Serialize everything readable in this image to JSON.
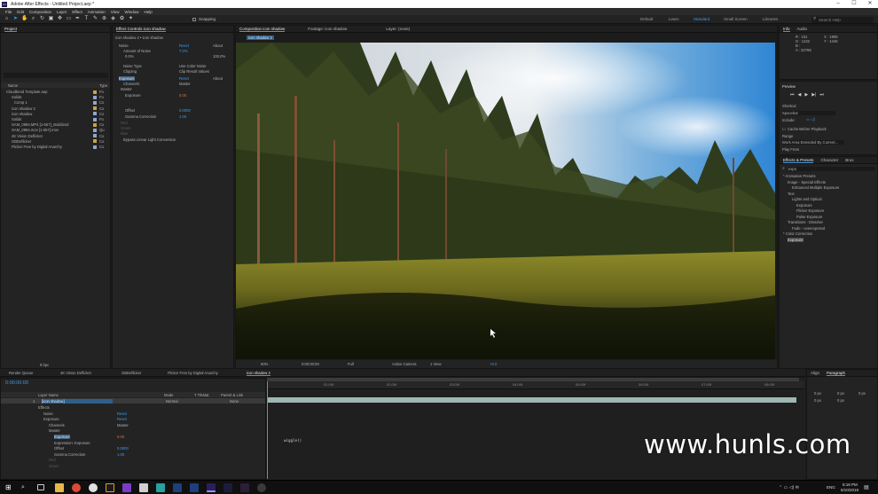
{
  "app": {
    "title": "Adobe After Effects - Untitled Project.aep *",
    "menu": [
      "File",
      "Edit",
      "Composition",
      "Layer",
      "Effect",
      "Animation",
      "View",
      "Window",
      "Help"
    ],
    "snapping_label": "Snapping"
  },
  "workspaces": {
    "items": [
      "Default",
      "Learn",
      "Standard",
      "Small Screen",
      "Libraries"
    ],
    "active": "Standard",
    "search_placeholder": "Search Help"
  },
  "project_panel": {
    "tab": "Project",
    "search_placeholder": "",
    "col_name": "Name",
    "col_type": "Type",
    "items": [
      {
        "name": "Cloudbend Template.aep",
        "type": "Fo"
      },
      {
        "name": "Solids",
        "type": "Fo"
      },
      {
        "name": "Comp 1",
        "type": "Co"
      },
      {
        "name": "icon shadow 2",
        "type": "Co"
      },
      {
        "name": "icon shadow",
        "type": "Co"
      },
      {
        "name": "Solids",
        "type": "Fo"
      },
      {
        "name": "SAM_0894.MP4 [1-557]_stabilized",
        "type": "Co"
      },
      {
        "name": "SAM_0894.mov [1-557].mov",
        "type": "Qu"
      },
      {
        "name": "4K Vision Deflicker",
        "type": "Co"
      },
      {
        "name": "GBDeflicker",
        "type": "Co"
      },
      {
        "name": "Flicker Free by Digital Anarchy",
        "type": "Co"
      }
    ],
    "bottom_label": "8 bpc"
  },
  "effect_controls": {
    "tab": "Effect Controls icon shadow",
    "header": "icon shadow 2 • icon shadow",
    "rows": [
      {
        "label": "Noise",
        "val1": "Reset",
        "val2": "About"
      },
      {
        "label": "Amount of Noise",
        "val1": "7.0%",
        "val2": ""
      },
      {
        "label": "0.0%",
        "val1": "",
        "val2": "100.0%"
      },
      {
        "label": "Noise Type",
        "val1": "Use Color Noise",
        "val2": ""
      },
      {
        "label": "Clipping",
        "val1": "Clip Result Values",
        "val2": ""
      },
      {
        "label": "Exposure",
        "val1": "Reset",
        "val2": "About"
      },
      {
        "label": "Channels:",
        "val1": "Master",
        "val2": ""
      },
      {
        "label": "Master",
        "val1": "",
        "val2": ""
      },
      {
        "label": "Exposure",
        "val1": "0.00",
        "val2": ""
      },
      {
        "label": "Offset",
        "val1": "0.0000",
        "val2": ""
      },
      {
        "label": "Gamma Correction",
        "val1": "1.00",
        "val2": ""
      },
      {
        "label": "Red",
        "val1": "",
        "val2": ""
      },
      {
        "label": "Green",
        "val1": "",
        "val2": ""
      },
      {
        "label": "Blue",
        "val1": "",
        "val2": ""
      },
      {
        "label": "Bypass Linear Light Conversion",
        "val1": "",
        "val2": ""
      }
    ]
  },
  "viewer": {
    "tabs": [
      "Composition icon shadow",
      "Footage: icon shadow",
      "Layer: (none)"
    ],
    "crumb": "icon shadow 2",
    "footer": {
      "zoom": "50%",
      "timecode": "0;00;00;00",
      "resolution": "Full",
      "camera": "Active Camera",
      "views": "1 View",
      "exposure": "+0.0"
    }
  },
  "info_panel": {
    "tabs": [
      "Info",
      "Audio"
    ],
    "r": "R : 151",
    "g": "G : 1232",
    "b": "B :",
    "a": "A : 32768",
    "x": "X : 1955",
    "y": "Y : 1346"
  },
  "preview_panel": {
    "title": "Preview",
    "shortcut_label": "Shortcut",
    "shortcut_value": "Spacebar",
    "include_label": "Include:",
    "cache_label": "Cache Before Playback",
    "range_label": "Range",
    "range_value": "Work Area Extended By Current...",
    "play_from_label": "Play From"
  },
  "effects_panel": {
    "tabs": [
      "Effects & Presets",
      "Character",
      "Brus"
    ],
    "search_value": "expo",
    "tree": [
      "* Animation Presets",
      "Image - Special Effects",
      "Enhanced Multiple Exposure",
      "Text",
      "Lights and Optical",
      "Exposure",
      "Flicker Exposure",
      "Pulse Exposure",
      "Transitions - Dissolve",
      "Fade - overexposed",
      "* Color Correction",
      "Exposure"
    ]
  },
  "bottom_tabs": [
    "Render Queue",
    "4K Vision Deflicker",
    "GBDeflicker",
    "Flicker Free by Digital Anarchy",
    "icon shadow 2"
  ],
  "timeline": {
    "timecode": "0:00:00:00",
    "headers": {
      "layer_name": "Layer Name",
      "mode": "Mode",
      "trkmat": "T TrkMat",
      "parent": "Parent & Link"
    },
    "layer": {
      "num": "1",
      "name": "[icon shadow]",
      "mode": "Normal",
      "parent": "None"
    },
    "props": [
      {
        "label": "Effects",
        "val": ""
      },
      {
        "label": "Noise",
        "val": "Reset"
      },
      {
        "label": "Exposure",
        "val": "Reset"
      },
      {
        "label": "Channels",
        "val": "Master"
      },
      {
        "label": "Master",
        "val": ""
      },
      {
        "label": "Exposure",
        "val": "0.00"
      },
      {
        "label": "Expression: Exposure",
        "val": ""
      },
      {
        "label": "Offset",
        "val": "0.0000"
      },
      {
        "label": "Gamma Correction",
        "val": "1.00"
      },
      {
        "label": "Red",
        "val": ""
      },
      {
        "label": "Green",
        "val": ""
      }
    ],
    "ruler": [
      "01:00f",
      "02:00f",
      "03:00f",
      "04:00f",
      "05:00f",
      "06:00f",
      "07:00f",
      "08:00f"
    ],
    "expression": "wiggle()"
  },
  "paragraph_panel": {
    "tabs": [
      "Align",
      "Paragraph"
    ],
    "fields": [
      "0 px",
      "0 px",
      "0 px",
      "0 px",
      "0 px"
    ]
  },
  "taskbar": {
    "time": "8:18 PM",
    "date": "6/10/2019",
    "lang": "ENG"
  },
  "watermark": "www.hunls.com",
  "colors": {
    "accent": "#3d9be9",
    "keyframe_orange": "#e2702f",
    "layer_bar": "#9fb7b3"
  }
}
